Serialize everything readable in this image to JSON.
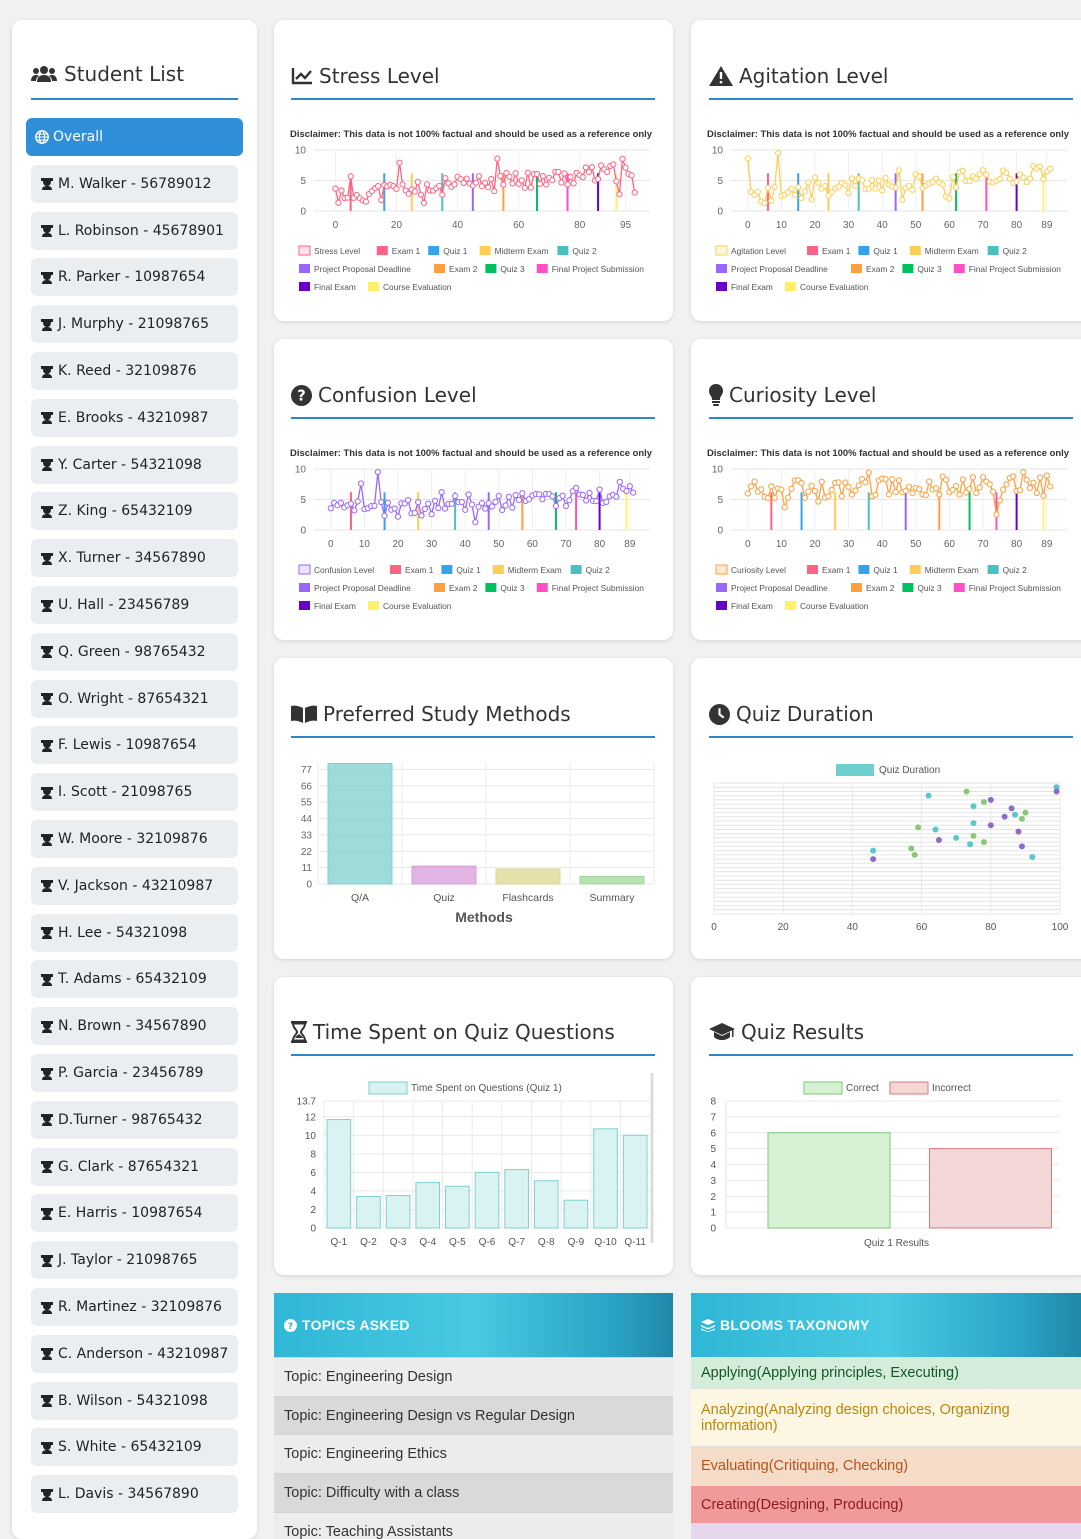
{
  "sidebar": {
    "title": "Student List",
    "items": [
      {
        "label": "Overall",
        "active": true
      },
      {
        "label": "M. Walker - 56789012"
      },
      {
        "label": "L. Robinson - 45678901"
      },
      {
        "label": "R. Parker - 10987654"
      },
      {
        "label": "J. Murphy - 21098765"
      },
      {
        "label": "K. Reed - 32109876"
      },
      {
        "label": "E. Brooks - 43210987"
      },
      {
        "label": "Y. Carter - 54321098"
      },
      {
        "label": "Z. King - 65432109"
      },
      {
        "label": "X. Turner - 34567890"
      },
      {
        "label": "U. Hall - 23456789"
      },
      {
        "label": "Q. Green - 98765432"
      },
      {
        "label": "O. Wright - 87654321"
      },
      {
        "label": "F. Lewis - 10987654"
      },
      {
        "label": "I. Scott - 21098765"
      },
      {
        "label": "W. Moore - 32109876"
      },
      {
        "label": "V. Jackson - 43210987"
      },
      {
        "label": "H. Lee - 54321098"
      },
      {
        "label": "T. Adams - 65432109"
      },
      {
        "label": "N. Brown - 34567890"
      },
      {
        "label": "P. Garcia - 23456789"
      },
      {
        "label": "D.Turner - 98765432"
      },
      {
        "label": "G. Clark - 87654321"
      },
      {
        "label": "E. Harris - 10987654"
      },
      {
        "label": "J. Taylor - 21098765"
      },
      {
        "label": "R. Martinez - 32109876"
      },
      {
        "label": "C. Anderson - 43210987"
      },
      {
        "label": "B. Wilson - 54321098"
      },
      {
        "label": "S. White - 65432109"
      },
      {
        "label": "L. Davis - 34567890"
      }
    ]
  },
  "cards": {
    "stress": {
      "title": "Stress Level",
      "icon": "chart-line-icon"
    },
    "agitation": {
      "title": "Agitation Level",
      "icon": "warning-icon"
    },
    "confusion": {
      "title": "Confusion Level",
      "icon": "question-circle-icon"
    },
    "curiosity": {
      "title": "Curiosity Level",
      "icon": "lightbulb-icon"
    },
    "study": {
      "title": "Preferred Study Methods",
      "icon": "book-open-icon"
    },
    "duration": {
      "title": "Quiz Duration",
      "icon": "clock-icon"
    },
    "timespent": {
      "title": "Time Spent on Quiz Questions",
      "icon": "hourglass-icon"
    },
    "results": {
      "title": "Quiz Results",
      "icon": "graduation-cap-icon"
    }
  },
  "disclaimer": "Disclaimer: This data is not 100% factual and should be used as a reference only",
  "event_legend": [
    {
      "label": "Exam 1",
      "color": "#ff6384"
    },
    {
      "label": "Quiz 1",
      "color": "#36a2eb"
    },
    {
      "label": "Midterm Exam",
      "color": "#ffcd56"
    },
    {
      "label": "Quiz 2",
      "color": "#4bc0c0"
    },
    {
      "label": "Project Proposal Deadline",
      "color": "#9966ff"
    },
    {
      "label": "Exam 2",
      "color": "#ff9f40"
    },
    {
      "label": "Quiz 3",
      "color": "#00c060"
    },
    {
      "label": "Final Project Submission",
      "color": "#ff4fc4"
    },
    {
      "label": "Final Exam",
      "color": "#6a00c8"
    },
    {
      "label": "Course Evaluation",
      "color": "#fff06a"
    }
  ],
  "chart_data": [
    {
      "id": "stress",
      "type": "line",
      "series": [
        {
          "name": "Stress Level",
          "color": "#ff6384",
          "seed": 11,
          "base": 2.5,
          "trend": 4
        }
      ],
      "x_ticks": [
        "0",
        "20",
        "40",
        "60",
        "80",
        "95"
      ],
      "x_range": [
        -7,
        103
      ],
      "ylim": [
        0,
        10
      ],
      "y_ticks": [
        0,
        5,
        10
      ],
      "events": [
        5,
        16,
        25,
        35,
        45,
        55,
        66,
        76,
        86,
        92
      ]
    },
    {
      "id": "agitation",
      "type": "line",
      "series": [
        {
          "name": "Agitation Level",
          "color": "#ffcd56",
          "seed": 23,
          "base": 2.5,
          "trend": 4
        }
      ],
      "x_ticks": [
        "0",
        "10",
        "20",
        "30",
        "40",
        "50",
        "60",
        "70",
        "80",
        "89"
      ],
      "x_range": [
        -5,
        95
      ],
      "ylim": [
        0,
        10
      ],
      "y_ticks": [
        0,
        5,
        10
      ],
      "events": [
        6,
        15,
        24,
        33,
        44,
        52,
        62,
        71,
        80,
        88
      ]
    },
    {
      "id": "confusion",
      "type": "line",
      "series": [
        {
          "name": "Confusion Level",
          "color": "#9966ff",
          "seed": 37,
          "base": 3,
          "trend": 3
        }
      ],
      "x_ticks": [
        "0",
        "10",
        "20",
        "30",
        "40",
        "50",
        "60",
        "70",
        "80",
        "89"
      ],
      "x_range": [
        -5,
        95
      ],
      "ylim": [
        0,
        10
      ],
      "y_ticks": [
        0,
        5,
        10
      ],
      "events": [
        6,
        16,
        26,
        37,
        47,
        57,
        67,
        73,
        80,
        88
      ]
    },
    {
      "id": "curiosity",
      "type": "line",
      "series": [
        {
          "name": "Curiosity Level",
          "color": "#ff9f40",
          "seed": 53,
          "base": 6.5,
          "trend": 1
        }
      ],
      "x_ticks": [
        "0",
        "10",
        "20",
        "30",
        "40",
        "50",
        "60",
        "70",
        "80",
        "89"
      ],
      "x_range": [
        -5,
        95
      ],
      "ylim": [
        0,
        10
      ],
      "y_ticks": [
        0,
        5,
        10
      ],
      "events": [
        7,
        16,
        26,
        36,
        47,
        57,
        66,
        74,
        80,
        88
      ]
    },
    {
      "id": "study",
      "type": "bar",
      "categories": [
        "Q/A",
        "Quiz",
        "Flashcards",
        "Summary"
      ],
      "values": [
        81,
        12,
        10,
        5
      ],
      "colors": [
        "#7fd0cc",
        "#d79bd9",
        "#d9d890",
        "#9fd89b"
      ],
      "y_ticks": [
        0,
        11,
        22,
        33,
        44,
        55,
        66,
        77
      ],
      "ylim": [
        0,
        82
      ],
      "xlabel": "Methods"
    },
    {
      "id": "duration",
      "type": "scatter",
      "legend": "Quiz Duration",
      "x_ticks": [
        0,
        20,
        40,
        60,
        80,
        100
      ],
      "xlim": [
        0,
        100
      ],
      "points": [
        {
          "x": 99,
          "y": 30,
          "c": "#5bc8c8"
        },
        {
          "x": 99,
          "y": 29,
          "c": "#8c6cc8"
        },
        {
          "x": 62,
          "y": 28,
          "c": "#5bc8c8"
        },
        {
          "x": 73,
          "y": 29,
          "c": "#8ac878"
        },
        {
          "x": 80,
          "y": 27,
          "c": "#8c6cc8"
        },
        {
          "x": 78,
          "y": 26.5,
          "c": "#8ac878"
        },
        {
          "x": 75,
          "y": 25.5,
          "c": "#5bc8c8"
        },
        {
          "x": 86,
          "y": 25,
          "c": "#8c6cc8"
        },
        {
          "x": 90,
          "y": 24,
          "c": "#8ac878"
        },
        {
          "x": 87,
          "y": 23.5,
          "c": "#5bc8c8"
        },
        {
          "x": 84,
          "y": 23,
          "c": "#8c6cc8"
        },
        {
          "x": 89,
          "y": 22.5,
          "c": "#8ac878"
        },
        {
          "x": 75,
          "y": 21.5,
          "c": "#5bc8c8"
        },
        {
          "x": 80,
          "y": 21,
          "c": "#8c6cc8"
        },
        {
          "x": 59,
          "y": 20.5,
          "c": "#8ac878"
        },
        {
          "x": 64,
          "y": 20,
          "c": "#5bc8c8"
        },
        {
          "x": 88,
          "y": 19.5,
          "c": "#8c6cc8"
        },
        {
          "x": 75,
          "y": 18.5,
          "c": "#8ac878"
        },
        {
          "x": 70,
          "y": 18,
          "c": "#5bc8c8"
        },
        {
          "x": 65,
          "y": 17.5,
          "c": "#8c6cc8"
        },
        {
          "x": 78,
          "y": 17,
          "c": "#8ac878"
        },
        {
          "x": 74,
          "y": 16.5,
          "c": "#5bc8c8"
        },
        {
          "x": 89,
          "y": 16,
          "c": "#8c6cc8"
        },
        {
          "x": 57,
          "y": 15.5,
          "c": "#8ac878"
        },
        {
          "x": 46,
          "y": 15,
          "c": "#5bc8c8"
        },
        {
          "x": 58,
          "y": 14,
          "c": "#8ac878"
        },
        {
          "x": 92,
          "y": 13.5,
          "c": "#5bc8c8"
        },
        {
          "x": 46,
          "y": 13,
          "c": "#8c6cc8"
        }
      ]
    },
    {
      "id": "timespent",
      "type": "bar",
      "series": [
        {
          "name": "Time Spent on Questions (Quiz 1)"
        }
      ],
      "categories": [
        "Q-1",
        "Q-2",
        "Q-3",
        "Q-4",
        "Q-5",
        "Q-6",
        "Q-7",
        "Q-8",
        "Q-9",
        "Q-10",
        "Q-11"
      ],
      "values": [
        11.7,
        3.4,
        3.5,
        4.9,
        4.5,
        6.0,
        6.3,
        5.1,
        3.0,
        10.7,
        10.0
      ],
      "y_ticks": [
        0,
        2,
        4,
        6,
        8,
        10,
        12,
        13.7
      ],
      "ylim": [
        0,
        13.7
      ]
    },
    {
      "id": "results",
      "type": "bar",
      "series": [
        {
          "name": "Correct",
          "values": [
            6
          ]
        },
        {
          "name": "Incorrect",
          "values": [
            5
          ]
        }
      ],
      "categories": [
        "Quiz 1 Results"
      ],
      "y_ticks": [
        0,
        1,
        2,
        3,
        4,
        5,
        6,
        7,
        8
      ],
      "ylim": [
        0,
        8
      ]
    }
  ],
  "topics": {
    "header": "TOPICS ASKED",
    "items": [
      "Topic: Engineering Design",
      "Topic: Engineering Design vs Regular Design",
      "Topic: Engineering Ethics",
      "Topic: Difficulty with a class",
      "Topic: Teaching Assistants"
    ]
  },
  "blooms": {
    "header": "BLOOMS TAXONOMY",
    "items": [
      {
        "label": "Applying(Applying principles, Executing)",
        "bg": "#d4edda",
        "fg": "#155724"
      },
      {
        "label": "Analyzing(Analyzing design choices, Organizing information)",
        "bg": "#fdf6e3",
        "fg": "#b8860b"
      },
      {
        "label": "Evaluating(Critiquing, Checking)",
        "bg": "#f5dcc8",
        "fg": "#b4531a"
      },
      {
        "label": "Creating(Designing, Producing)",
        "bg": "#f19a9c",
        "fg": "#8a1d1d"
      }
    ]
  }
}
